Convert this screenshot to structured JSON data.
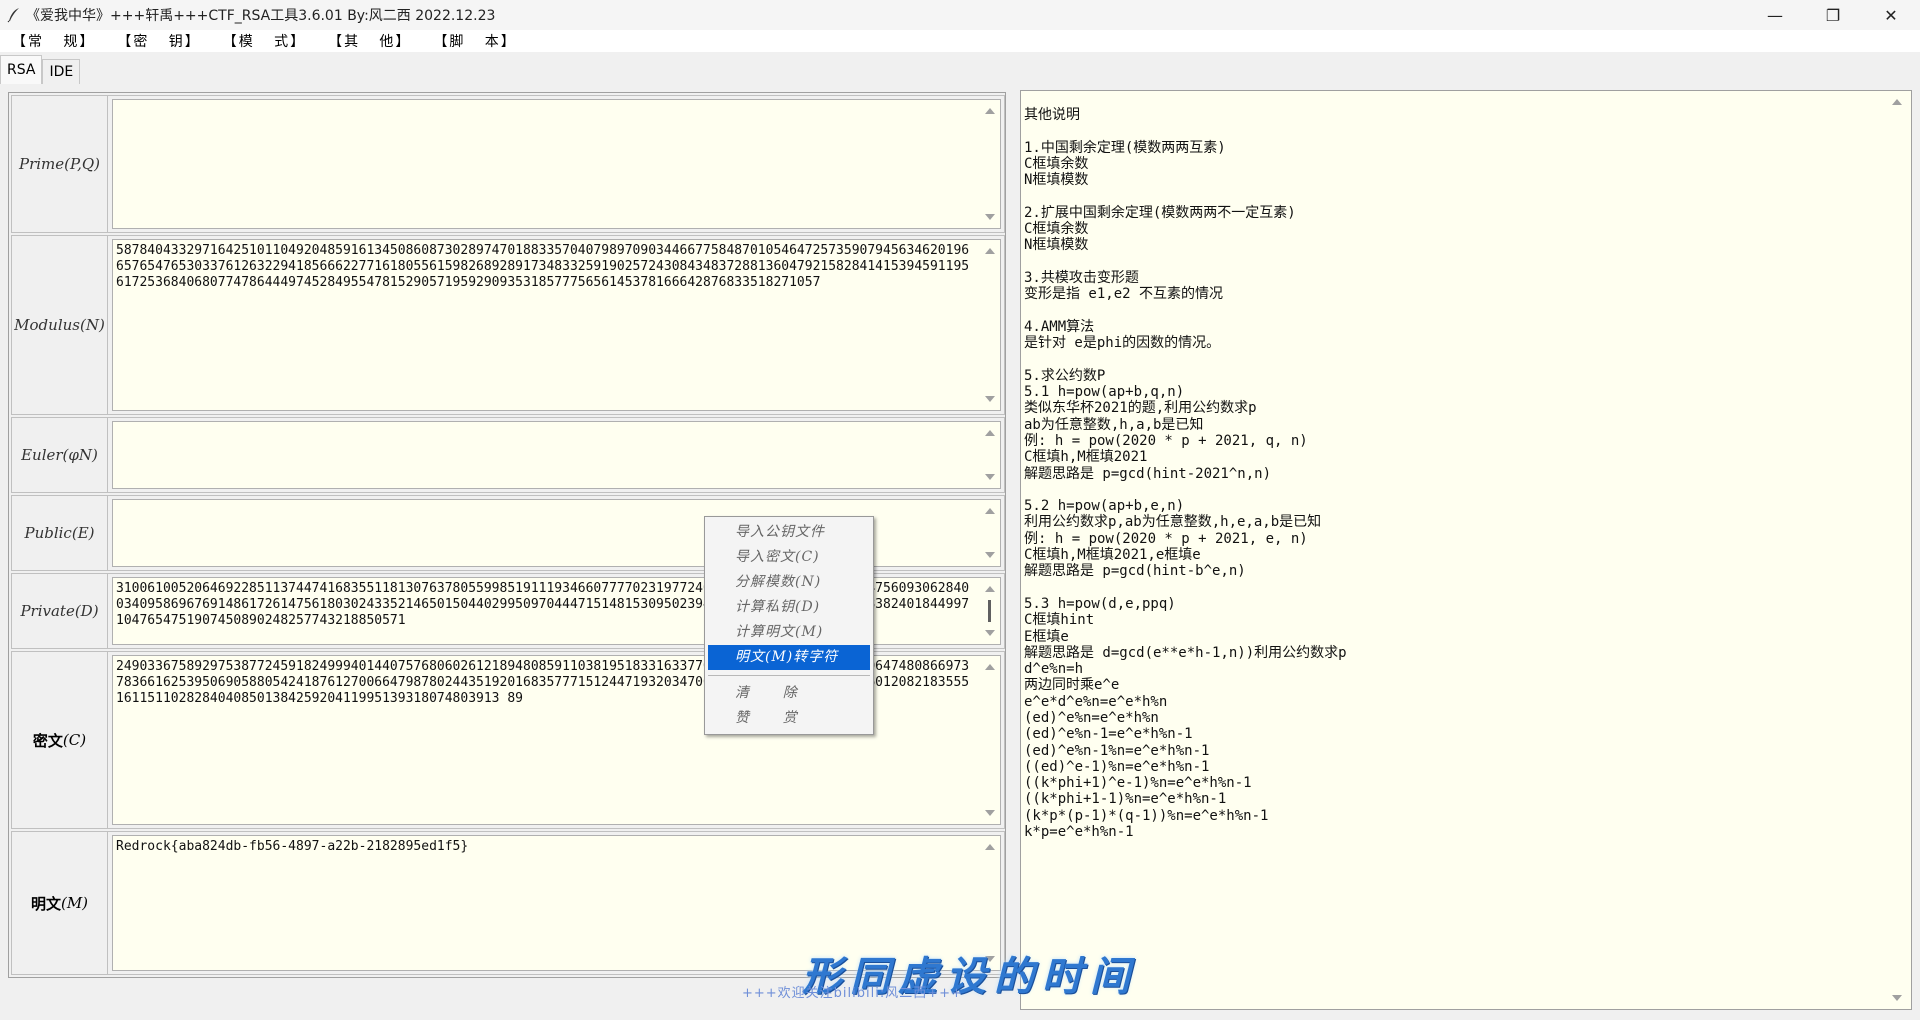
{
  "window": {
    "title": "《爱我中华》+++轩禹+++CTF_RSA工具3.6.01   By:风二西 2022.12.23",
    "controls": {
      "minimize": "—",
      "maximize": "❐",
      "close": "✕"
    }
  },
  "menu": [
    "【常   规】",
    "【密   钥】",
    "【模   式】",
    "【其   他】",
    "【脚   本】"
  ],
  "tabs": [
    "RSA",
    "IDE"
  ],
  "fields": {
    "prime": {
      "label": "Prime(P,Q)",
      "value": ""
    },
    "modulus": {
      "label": "Modulus(N)",
      "value": "58784043329716425101104920485916134508608730289747018833570407989709034466775848701054647257359079456346201966576547653033761263229418566622771618055615982689289173483325919025724308434837288136047921582841415394591195617253684068077478644497452849554781529057195929093531857775656145378166642876833518271057"
    },
    "euler": {
      "label": "Euler(φN)",
      "value": ""
    },
    "public": {
      "label": "Public(E)",
      "value": ""
    },
    "private": {
      "label": "Private(D)",
      "value": "310061005206469228511374474168355118130763780559985191119346607777023197724016446659101743413061475609306284003409586967691486172614756180302433521465015044029950970444715148153095023946208024000298882712183824018449971047654751907450890248257743218850571"
    },
    "cipher": {
      "label_main": "密文",
      "label_suffix": "(C)",
      "value": "249033675892975387724591824999401440757680602612189480859110381951833163377024046631012233502913064748086697378366162539506905880542418761270066479878024435192016835777151244719320347067934531188000994153260120821835551611511028284040850138425920411995139318074803913 89"
    },
    "plain": {
      "label_main": "明文",
      "label_suffix": "(M)",
      "value": "Redrock{aba824db-fb56-4897-a22b-2182895ed1f5}"
    }
  },
  "notes": "其他说明\n\n1.中国剩余定理(模数两两互素)\nC框填余数\nN框填模数\n\n2.扩展中国剩余定理(模数两两不一定互素)\nC框填余数\nN框填模数\n\n3.共模攻击变形题\n变形是指 e1,e2 不互素的情况\n\n4.AMM算法\n是针对 e是phi的因数的情况。\n\n5.求公约数P\n5.1 h=pow(ap+b,q,n)\n类似东华杯2021的题,利用公约数求p\nab为任意整数,h,a,b是已知\n例: h = pow(2020 * p + 2021, q, n)\nC框填h,M框填2021\n解题思路是 p=gcd(hint-2021^n,n)\n\n5.2 h=pow(ap+b,e,n)\n利用公约数求p,ab为任意整数,h,e,a,b是已知\n例: h = pow(2020 * p + 2021, e, n)\nC框填h,M框填2021,e框填e\n解题思路是 p=gcd(hint-b^e,n)\n\n5.3 h=pow(d,e,ppq)\nC框填hint\nE框填e\n解题思路是 d=gcd(e**e*h-1,n))利用公约数求p\nd^e%n=h\n两边同时乘e^e\ne^e*d^e%n=e^e*h%n\n(ed)^e%n=e^e*h%n\n(ed)^e%n-1=e^e*h%n-1\n(ed)^e%n-1%n=e^e*h%n-1\n((ed)^e-1)%n=e^e*h%n-1\n((k*phi+1)^e-1)%n=e^e*h%n-1\n((k*phi+1-1)%n=e^e*h%n-1\n(k*p*(p-1)*(q-1))%n=e^e*h%n-1\nk*p=e^e*h%n-1",
  "context_menu": {
    "items": [
      "导入公钥文件",
      "导入密文(C)",
      "分解模数(N)",
      "计算私钥(D)",
      "计算明文(M)",
      "明文(M)转字符"
    ],
    "selected_index": 5,
    "extra": [
      "清      除",
      "赞      赏"
    ]
  },
  "watermark": {
    "big": "形同虚设的时间",
    "small": "+++欢迎关注bilibili:风二西+++"
  },
  "colors": {
    "field_bg": "#fffff0",
    "selection": "#0a64d4",
    "watermark": "#2f78d0"
  }
}
